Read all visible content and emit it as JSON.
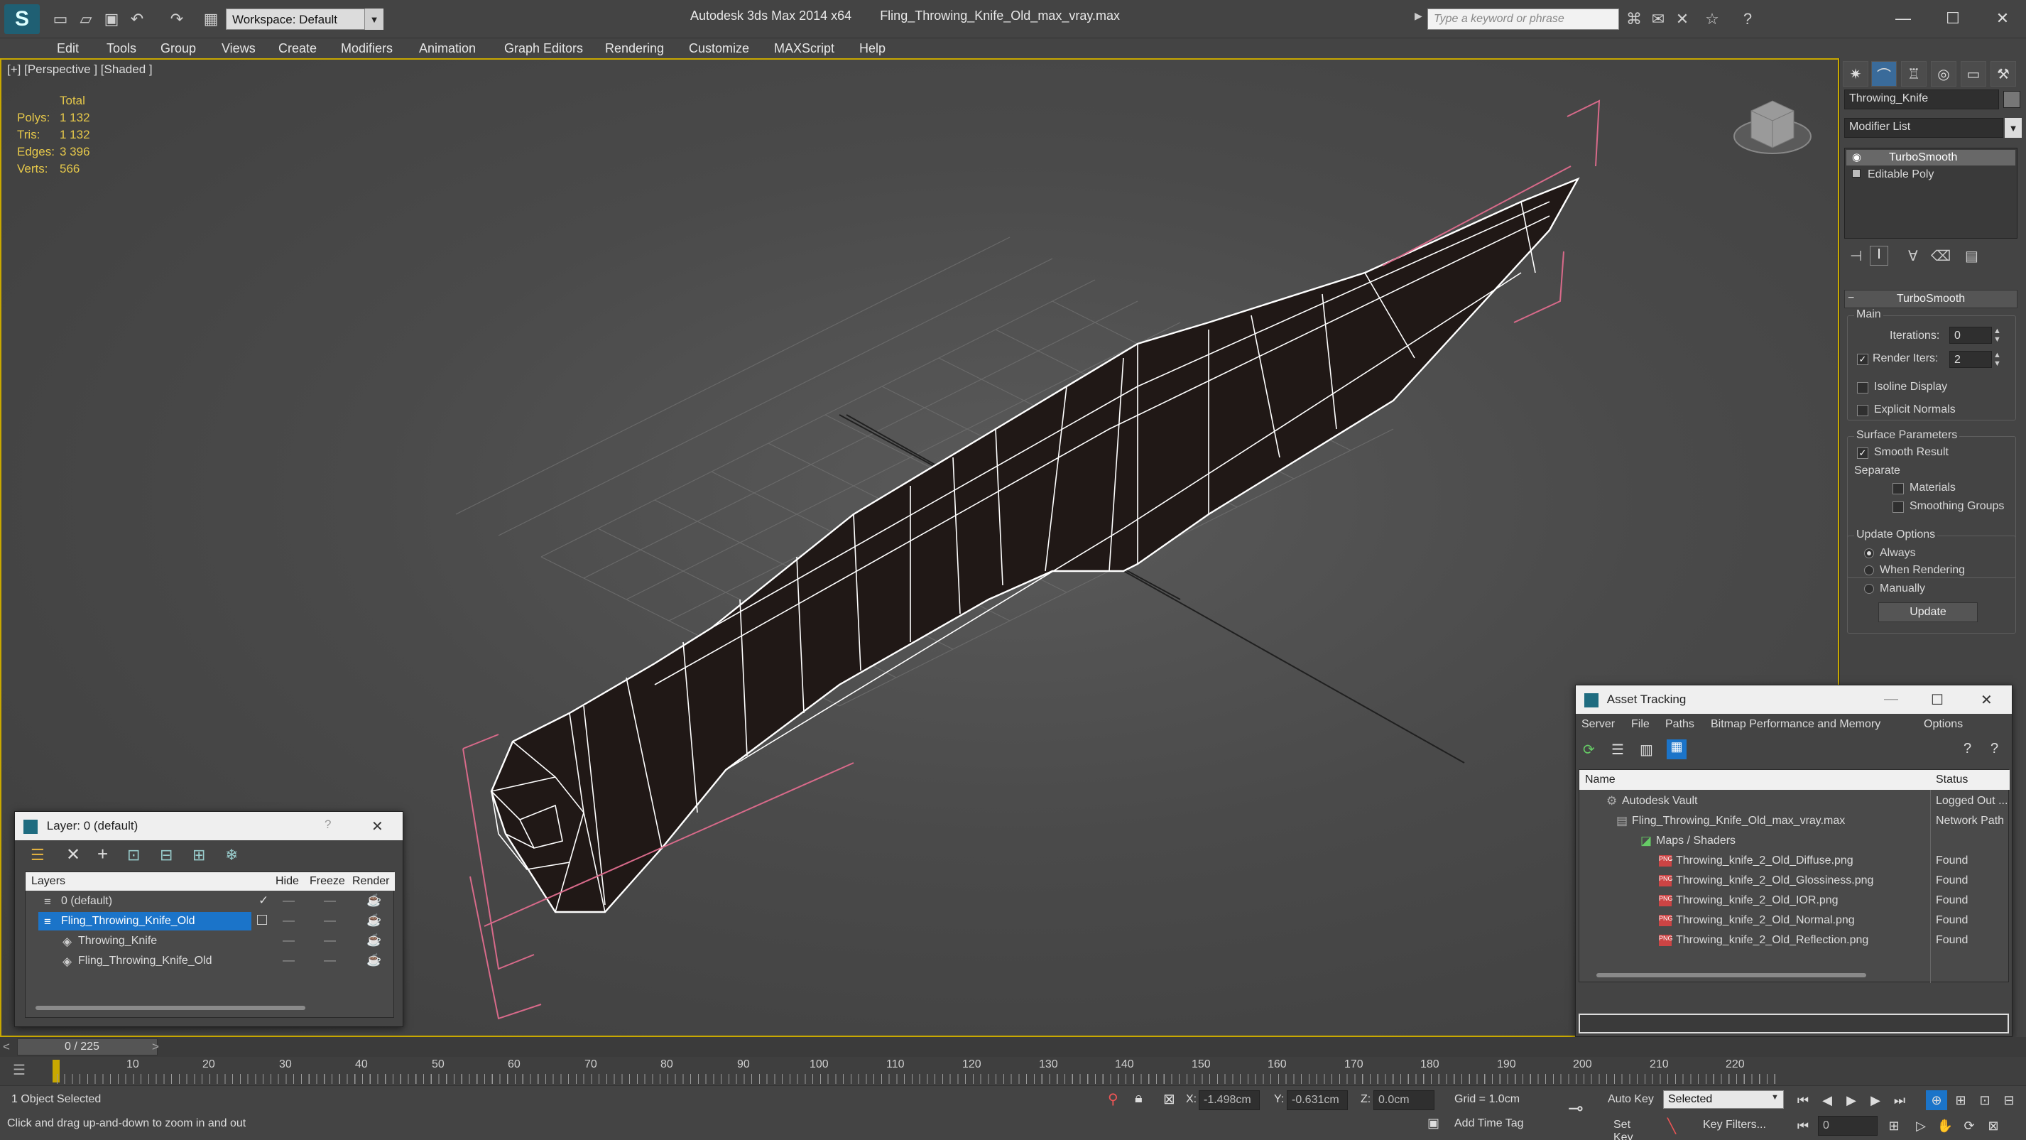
{
  "title_bar": {
    "app_title": "Autodesk 3ds Max  2014 x64",
    "file_name": "Fling_Throwing_Knife_Old_max_vray.max",
    "workspace": "Workspace: Default",
    "search_placeholder": "Type a keyword or phrase"
  },
  "menu": [
    "Edit",
    "Tools",
    "Group",
    "Views",
    "Create",
    "Modifiers",
    "Animation",
    "Graph Editors",
    "Rendering",
    "Customize",
    "MAXScript",
    "Help"
  ],
  "viewport": {
    "label": "[+] [Perspective ] [Shaded ]",
    "stats": {
      "header": "Total",
      "rows": [
        {
          "label": "Polys:",
          "value": "1 132"
        },
        {
          "label": "Tris:",
          "value": "1 132"
        },
        {
          "label": "Edges:",
          "value": "3 396"
        },
        {
          "label": "Verts:",
          "value": "566"
        }
      ]
    }
  },
  "command_panel": {
    "object_name": "Throwing_Knife",
    "modifier_list": "Modifier List",
    "stack": [
      "TurboSmooth",
      "Editable Poly"
    ],
    "rollout_title": "TurboSmooth",
    "main_group": "Main",
    "iterations_label": "Iterations:",
    "iterations_value": "0",
    "render_iters_label": "Render Iters:",
    "render_iters_value": "2",
    "isoline_display": "Isoline Display",
    "explicit_normals": "Explicit Normals",
    "surface_parameters": "Surface Parameters",
    "smooth_result": "Smooth Result",
    "separate": "Separate",
    "materials": "Materials",
    "smoothing_groups": "Smoothing Groups",
    "update_options": "Update Options",
    "always": "Always",
    "when_rendering": "When Rendering",
    "manually": "Manually",
    "update_button": "Update"
  },
  "layer_window": {
    "title": "Layer: 0 (default)",
    "help": "?",
    "columns": [
      "Layers",
      "Hide",
      "Freeze",
      "Render"
    ],
    "rows": [
      {
        "name": "0 (default)"
      },
      {
        "name": "Fling_Throwing_Knife_Old"
      },
      {
        "name": "Throwing_Knife"
      },
      {
        "name": "Fling_Throwing_Knife_Old"
      }
    ]
  },
  "asset_tracking": {
    "title": "Asset Tracking",
    "menu": [
      "Server",
      "File",
      "Paths",
      "Bitmap Performance and Memory",
      "Options"
    ],
    "columns": [
      "Name",
      "Status"
    ],
    "rows": [
      {
        "name": "Autodesk Vault",
        "status": "Logged Out ..."
      },
      {
        "name": "Fling_Throwing_Knife_Old_max_vray.max",
        "status": "Network Path"
      },
      {
        "name": "Maps / Shaders",
        "status": ""
      },
      {
        "name": "Throwing_knife_2_Old_Diffuse.png",
        "status": "Found"
      },
      {
        "name": "Throwing_knife_2_Old_Glossiness.png",
        "status": "Found"
      },
      {
        "name": "Throwing_knife_2_Old_IOR.png",
        "status": "Found"
      },
      {
        "name": "Throwing_knife_2_Old_Normal.png",
        "status": "Found"
      },
      {
        "name": "Throwing_knife_2_Old_Reflection.png",
        "status": "Found"
      }
    ]
  },
  "timeline": {
    "frame": "0 / 225",
    "ticks": [
      "10",
      "20",
      "30",
      "40",
      "50",
      "60",
      "70",
      "80",
      "90",
      "100",
      "110",
      "120",
      "130",
      "140",
      "150",
      "160",
      "170",
      "180",
      "190",
      "200",
      "210",
      "220"
    ]
  },
  "status_bar": {
    "selection": "1 Object Selected",
    "prompt": "Click and drag up-and-down to zoom in and out",
    "x_label": "X:",
    "x_value": "-1.498cm",
    "y_label": "Y:",
    "y_value": "-0.631cm",
    "z_label": "Z:",
    "z_value": "0.0cm",
    "grid": "Grid = 1.0cm",
    "add_time_tag": "Add Time Tag",
    "auto_key": "Auto Key",
    "selected": "Selected",
    "set_key": "Set Key",
    "key_filters": "Key Filters...",
    "frame_value": "0"
  },
  "colors": {
    "accent_blue": "#1b74c9",
    "viewport_border": "#c8a800",
    "stats_yellow": "#e6c84a",
    "bbox_pink": "#d86a8a",
    "wire_white": "#ffffff"
  }
}
